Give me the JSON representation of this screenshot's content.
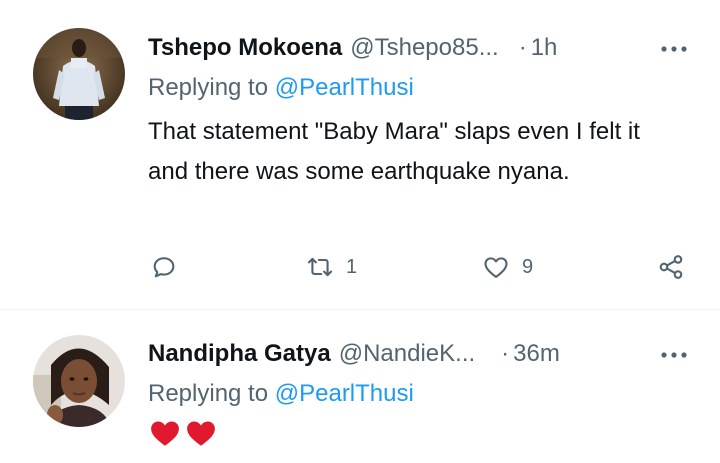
{
  "tweets": [
    {
      "name": "Tshepo Mokoena",
      "handle": "@Tshepo85...",
      "separator": "·",
      "time": "1h",
      "replying_label": "Replying to",
      "replying_to": "@PearlThusi",
      "text": "That statement \"Baby Mara\" slaps even I felt it and there was some earthquake nyana.",
      "reply_count": "",
      "retweet_count": "1",
      "like_count": "9",
      "avatar_icon": "person-photo-avatar",
      "more_icon": "more-dots-icon"
    },
    {
      "name": "Nandipha Gatya",
      "handle": "@NandieK...",
      "separator": "·",
      "time": "36m",
      "replying_label": "Replying to",
      "replying_to": "@PearlThusi",
      "emoji": "❤❤",
      "avatar_icon": "person-photo-avatar",
      "more_icon": "more-dots-icon"
    }
  ],
  "colors": {
    "text": "#0f1419",
    "secondary": "#536471",
    "link": "#1d9bf0",
    "divider": "#eff3f4",
    "heart": "#f91880"
  }
}
